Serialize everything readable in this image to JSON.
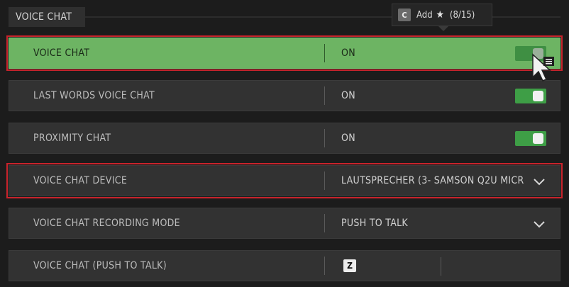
{
  "section": {
    "title": "VOICE CHAT"
  },
  "tooltip": {
    "key": "C",
    "text": "Add",
    "star": "★",
    "count": "(8/15)"
  },
  "rows": [
    {
      "label": "VOICE CHAT",
      "value": "ON",
      "control": "toggle",
      "state": "on"
    },
    {
      "label": "LAST WORDS VOICE CHAT",
      "value": "ON",
      "control": "toggle",
      "state": "on"
    },
    {
      "label": "PROXIMITY CHAT",
      "value": "ON",
      "control": "toggle",
      "state": "on"
    },
    {
      "label": "VOICE CHAT DEVICE",
      "value": "LAUTSPRECHER (3- SAMSON Q2U MICR",
      "control": "dropdown"
    },
    {
      "label": "VOICE CHAT RECORDING MODE",
      "value": "PUSH TO TALK",
      "control": "dropdown"
    },
    {
      "label": "VOICE CHAT (PUSH TO TALK)",
      "key": "Z",
      "control": "keybind"
    }
  ],
  "colors": {
    "highlight": "#6db463",
    "toggle_on": "#3e9e46",
    "outline": "#c8232c",
    "background": "#1c1c1c"
  }
}
